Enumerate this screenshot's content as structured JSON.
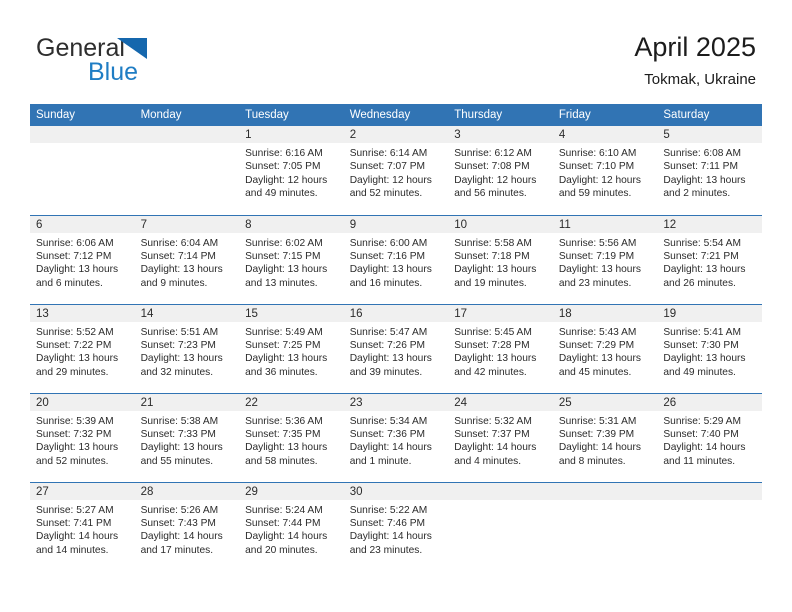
{
  "brand": {
    "name_part1": "General",
    "name_part2": "Blue",
    "flag_icon": "triangle-flag-icon"
  },
  "header": {
    "title": "April 2025",
    "subtitle": "Tokmak, Ukraine"
  },
  "colors": {
    "header_blue": "#3174b4",
    "brand_blue": "#1f7dc4",
    "daynum_band": "#f0f0f0",
    "text": "#2b2b2b"
  },
  "weekday_headers": [
    "Sunday",
    "Monday",
    "Tuesday",
    "Wednesday",
    "Thursday",
    "Friday",
    "Saturday"
  ],
  "weeks": [
    [
      {
        "day": "",
        "empty": true,
        "sunrise": "",
        "sunset": "",
        "daylight_line1": "",
        "daylight_line2": ""
      },
      {
        "day": "",
        "empty": true,
        "sunrise": "",
        "sunset": "",
        "daylight_line1": "",
        "daylight_line2": ""
      },
      {
        "day": "1",
        "empty": false,
        "sunrise": "Sunrise: 6:16 AM",
        "sunset": "Sunset: 7:05 PM",
        "daylight_line1": "Daylight: 12 hours",
        "daylight_line2": "and 49 minutes."
      },
      {
        "day": "2",
        "empty": false,
        "sunrise": "Sunrise: 6:14 AM",
        "sunset": "Sunset: 7:07 PM",
        "daylight_line1": "Daylight: 12 hours",
        "daylight_line2": "and 52 minutes."
      },
      {
        "day": "3",
        "empty": false,
        "sunrise": "Sunrise: 6:12 AM",
        "sunset": "Sunset: 7:08 PM",
        "daylight_line1": "Daylight: 12 hours",
        "daylight_line2": "and 56 minutes."
      },
      {
        "day": "4",
        "empty": false,
        "sunrise": "Sunrise: 6:10 AM",
        "sunset": "Sunset: 7:10 PM",
        "daylight_line1": "Daylight: 12 hours",
        "daylight_line2": "and 59 minutes."
      },
      {
        "day": "5",
        "empty": false,
        "sunrise": "Sunrise: 6:08 AM",
        "sunset": "Sunset: 7:11 PM",
        "daylight_line1": "Daylight: 13 hours",
        "daylight_line2": "and 2 minutes."
      }
    ],
    [
      {
        "day": "6",
        "empty": false,
        "sunrise": "Sunrise: 6:06 AM",
        "sunset": "Sunset: 7:12 PM",
        "daylight_line1": "Daylight: 13 hours",
        "daylight_line2": "and 6 minutes."
      },
      {
        "day": "7",
        "empty": false,
        "sunrise": "Sunrise: 6:04 AM",
        "sunset": "Sunset: 7:14 PM",
        "daylight_line1": "Daylight: 13 hours",
        "daylight_line2": "and 9 minutes."
      },
      {
        "day": "8",
        "empty": false,
        "sunrise": "Sunrise: 6:02 AM",
        "sunset": "Sunset: 7:15 PM",
        "daylight_line1": "Daylight: 13 hours",
        "daylight_line2": "and 13 minutes."
      },
      {
        "day": "9",
        "empty": false,
        "sunrise": "Sunrise: 6:00 AM",
        "sunset": "Sunset: 7:16 PM",
        "daylight_line1": "Daylight: 13 hours",
        "daylight_line2": "and 16 minutes."
      },
      {
        "day": "10",
        "empty": false,
        "sunrise": "Sunrise: 5:58 AM",
        "sunset": "Sunset: 7:18 PM",
        "daylight_line1": "Daylight: 13 hours",
        "daylight_line2": "and 19 minutes."
      },
      {
        "day": "11",
        "empty": false,
        "sunrise": "Sunrise: 5:56 AM",
        "sunset": "Sunset: 7:19 PM",
        "daylight_line1": "Daylight: 13 hours",
        "daylight_line2": "and 23 minutes."
      },
      {
        "day": "12",
        "empty": false,
        "sunrise": "Sunrise: 5:54 AM",
        "sunset": "Sunset: 7:21 PM",
        "daylight_line1": "Daylight: 13 hours",
        "daylight_line2": "and 26 minutes."
      }
    ],
    [
      {
        "day": "13",
        "empty": false,
        "sunrise": "Sunrise: 5:52 AM",
        "sunset": "Sunset: 7:22 PM",
        "daylight_line1": "Daylight: 13 hours",
        "daylight_line2": "and 29 minutes."
      },
      {
        "day": "14",
        "empty": false,
        "sunrise": "Sunrise: 5:51 AM",
        "sunset": "Sunset: 7:23 PM",
        "daylight_line1": "Daylight: 13 hours",
        "daylight_line2": "and 32 minutes."
      },
      {
        "day": "15",
        "empty": false,
        "sunrise": "Sunrise: 5:49 AM",
        "sunset": "Sunset: 7:25 PM",
        "daylight_line1": "Daylight: 13 hours",
        "daylight_line2": "and 36 minutes."
      },
      {
        "day": "16",
        "empty": false,
        "sunrise": "Sunrise: 5:47 AM",
        "sunset": "Sunset: 7:26 PM",
        "daylight_line1": "Daylight: 13 hours",
        "daylight_line2": "and 39 minutes."
      },
      {
        "day": "17",
        "empty": false,
        "sunrise": "Sunrise: 5:45 AM",
        "sunset": "Sunset: 7:28 PM",
        "daylight_line1": "Daylight: 13 hours",
        "daylight_line2": "and 42 minutes."
      },
      {
        "day": "18",
        "empty": false,
        "sunrise": "Sunrise: 5:43 AM",
        "sunset": "Sunset: 7:29 PM",
        "daylight_line1": "Daylight: 13 hours",
        "daylight_line2": "and 45 minutes."
      },
      {
        "day": "19",
        "empty": false,
        "sunrise": "Sunrise: 5:41 AM",
        "sunset": "Sunset: 7:30 PM",
        "daylight_line1": "Daylight: 13 hours",
        "daylight_line2": "and 49 minutes."
      }
    ],
    [
      {
        "day": "20",
        "empty": false,
        "sunrise": "Sunrise: 5:39 AM",
        "sunset": "Sunset: 7:32 PM",
        "daylight_line1": "Daylight: 13 hours",
        "daylight_line2": "and 52 minutes."
      },
      {
        "day": "21",
        "empty": false,
        "sunrise": "Sunrise: 5:38 AM",
        "sunset": "Sunset: 7:33 PM",
        "daylight_line1": "Daylight: 13 hours",
        "daylight_line2": "and 55 minutes."
      },
      {
        "day": "22",
        "empty": false,
        "sunrise": "Sunrise: 5:36 AM",
        "sunset": "Sunset: 7:35 PM",
        "daylight_line1": "Daylight: 13 hours",
        "daylight_line2": "and 58 minutes."
      },
      {
        "day": "23",
        "empty": false,
        "sunrise": "Sunrise: 5:34 AM",
        "sunset": "Sunset: 7:36 PM",
        "daylight_line1": "Daylight: 14 hours",
        "daylight_line2": "and 1 minute."
      },
      {
        "day": "24",
        "empty": false,
        "sunrise": "Sunrise: 5:32 AM",
        "sunset": "Sunset: 7:37 PM",
        "daylight_line1": "Daylight: 14 hours",
        "daylight_line2": "and 4 minutes."
      },
      {
        "day": "25",
        "empty": false,
        "sunrise": "Sunrise: 5:31 AM",
        "sunset": "Sunset: 7:39 PM",
        "daylight_line1": "Daylight: 14 hours",
        "daylight_line2": "and 8 minutes."
      },
      {
        "day": "26",
        "empty": false,
        "sunrise": "Sunrise: 5:29 AM",
        "sunset": "Sunset: 7:40 PM",
        "daylight_line1": "Daylight: 14 hours",
        "daylight_line2": "and 11 minutes."
      }
    ],
    [
      {
        "day": "27",
        "empty": false,
        "sunrise": "Sunrise: 5:27 AM",
        "sunset": "Sunset: 7:41 PM",
        "daylight_line1": "Daylight: 14 hours",
        "daylight_line2": "and 14 minutes."
      },
      {
        "day": "28",
        "empty": false,
        "sunrise": "Sunrise: 5:26 AM",
        "sunset": "Sunset: 7:43 PM",
        "daylight_line1": "Daylight: 14 hours",
        "daylight_line2": "and 17 minutes."
      },
      {
        "day": "29",
        "empty": false,
        "sunrise": "Sunrise: 5:24 AM",
        "sunset": "Sunset: 7:44 PM",
        "daylight_line1": "Daylight: 14 hours",
        "daylight_line2": "and 20 minutes."
      },
      {
        "day": "30",
        "empty": false,
        "sunrise": "Sunrise: 5:22 AM",
        "sunset": "Sunset: 7:46 PM",
        "daylight_line1": "Daylight: 14 hours",
        "daylight_line2": "and 23 minutes."
      },
      {
        "day": "",
        "empty": true,
        "sunrise": "",
        "sunset": "",
        "daylight_line1": "",
        "daylight_line2": ""
      },
      {
        "day": "",
        "empty": true,
        "sunrise": "",
        "sunset": "",
        "daylight_line1": "",
        "daylight_line2": ""
      },
      {
        "day": "",
        "empty": true,
        "sunrise": "",
        "sunset": "",
        "daylight_line1": "",
        "daylight_line2": ""
      }
    ]
  ]
}
